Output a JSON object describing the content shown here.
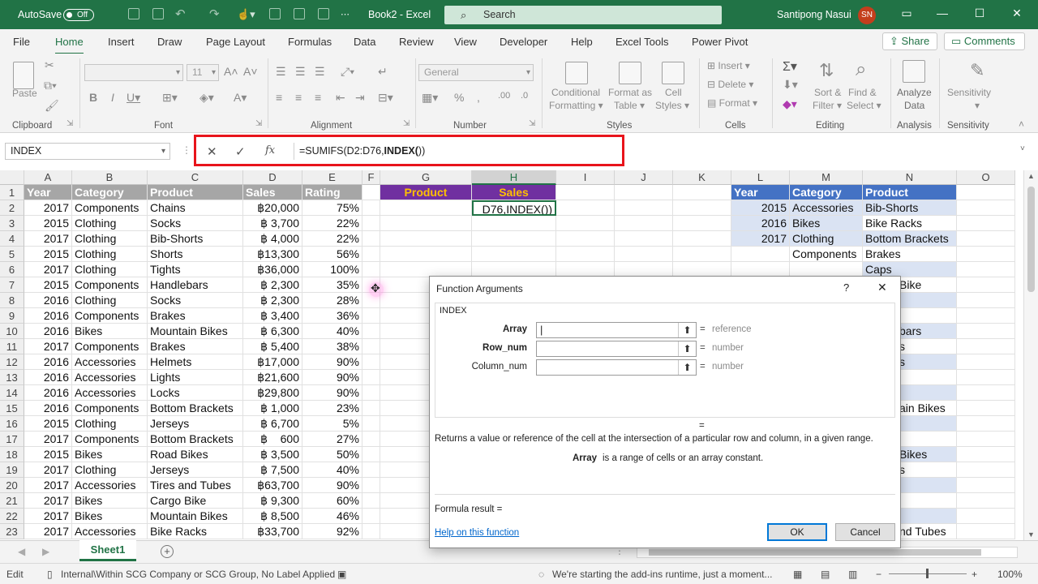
{
  "titlebar": {
    "autosave_label": "AutoSave",
    "autosave_state": "Off",
    "doc_title": "Book2 - Excel",
    "search_placeholder": "Search",
    "user_name": "Santipong Nasui",
    "user_initials": "SN"
  },
  "menu": {
    "items": [
      "File",
      "Home",
      "Insert",
      "Draw",
      "Page Layout",
      "Formulas",
      "Data",
      "Review",
      "View",
      "Developer",
      "Help",
      "Excel Tools",
      "Power Pivot"
    ],
    "active": "Home",
    "share_label": "Share",
    "comments_label": "Comments"
  },
  "ribbon": {
    "groups": [
      "Clipboard",
      "Font",
      "Alignment",
      "Number",
      "Styles",
      "Cells",
      "Editing",
      "Analysis",
      "Sensitivity"
    ],
    "paste": "Paste",
    "font_size": "11",
    "number_format": "General",
    "conditional_formatting": [
      "Conditional",
      "Formatting ▾"
    ],
    "format_as_table": [
      "Format as",
      "Table ▾"
    ],
    "cell_styles": [
      "Cell",
      "Styles ▾"
    ],
    "insert": "Insert",
    "delete": "Delete",
    "format": "Format",
    "sort_filter": [
      "Sort &",
      "Filter ▾"
    ],
    "find_select": [
      "Find &",
      "Select ▾"
    ],
    "analyze_data": [
      "Analyze",
      "Data"
    ],
    "sensitivity": "Sensitivity"
  },
  "formula_bar": {
    "name_box": "INDEX",
    "formula_prefix": "=SUMIFS(D2:D76,",
    "formula_bold": "INDEX(",
    "formula_suffix": "))"
  },
  "columns": [
    "A",
    "B",
    "C",
    "D",
    "E",
    "F",
    "G",
    "H",
    "I",
    "J",
    "K",
    "L",
    "M",
    "N",
    "O"
  ],
  "rows": [
    "1",
    "2",
    "3",
    "4",
    "5",
    "6",
    "7",
    "8",
    "9",
    "10",
    "11",
    "12",
    "13",
    "14",
    "15",
    "16",
    "17",
    "18",
    "19",
    "20",
    "21",
    "22",
    "23"
  ],
  "table_main": {
    "headers": [
      "Year",
      "Category",
      "Product",
      "Sales",
      "Rating"
    ],
    "data": [
      [
        "2017",
        "Components",
        "Chains",
        "฿20,000",
        "75%"
      ],
      [
        "2015",
        "Clothing",
        "Socks",
        "฿ 3,700",
        "22%"
      ],
      [
        "2017",
        "Clothing",
        "Bib-Shorts",
        "฿ 4,000",
        "22%"
      ],
      [
        "2015",
        "Clothing",
        "Shorts",
        "฿13,300",
        "56%"
      ],
      [
        "2017",
        "Clothing",
        "Tights",
        "฿36,000",
        "100%"
      ],
      [
        "2015",
        "Components",
        "Handlebars",
        "฿ 2,300",
        "35%"
      ],
      [
        "2016",
        "Clothing",
        "Socks",
        "฿ 2,300",
        "28%"
      ],
      [
        "2016",
        "Components",
        "Brakes",
        "฿ 3,400",
        "36%"
      ],
      [
        "2016",
        "Bikes",
        "Mountain Bikes",
        "฿ 6,300",
        "40%"
      ],
      [
        "2017",
        "Components",
        "Brakes",
        "฿ 5,400",
        "38%"
      ],
      [
        "2016",
        "Accessories",
        "Helmets",
        "฿17,000",
        "90%"
      ],
      [
        "2016",
        "Accessories",
        "Lights",
        "฿21,600",
        "90%"
      ],
      [
        "2016",
        "Accessories",
        "Locks",
        "฿29,800",
        "90%"
      ],
      [
        "2016",
        "Components",
        "Bottom Brackets",
        "฿ 1,000",
        "23%"
      ],
      [
        "2015",
        "Clothing",
        "Jerseys",
        "฿ 6,700",
        "5%"
      ],
      [
        "2017",
        "Components",
        "Bottom Brackets",
        "฿    600",
        "27%"
      ],
      [
        "2015",
        "Bikes",
        "Road Bikes",
        "฿ 3,500",
        "50%"
      ],
      [
        "2017",
        "Clothing",
        "Jerseys",
        "฿ 7,500",
        "40%"
      ],
      [
        "2017",
        "Accessories",
        "Tires and Tubes",
        "฿63,700",
        "90%"
      ],
      [
        "2017",
        "Bikes",
        "Cargo Bike",
        "฿ 9,300",
        "60%"
      ],
      [
        "2017",
        "Bikes",
        "Mountain Bikes",
        "฿ 8,500",
        "46%"
      ],
      [
        "2017",
        "Accessories",
        "Bike Racks",
        "฿33,700",
        "92%"
      ]
    ]
  },
  "criteria": {
    "product_header": "Product",
    "sales_header": "Sales",
    "active_cell_text": "D76,INDEX())"
  },
  "lists": {
    "headers": [
      "Year",
      "Category",
      "Product"
    ],
    "years": [
      "2015",
      "2016",
      "2017"
    ],
    "categories": [
      "Accessories",
      "Bikes",
      "Clothing",
      "Components"
    ],
    "products": [
      "Bib-Shorts",
      "Bike Racks",
      "Bottom Brackets",
      "Brakes",
      "Caps",
      "Bike",
      "",
      "",
      "bars",
      "s",
      "s",
      "",
      "",
      "ain Bikes",
      "",
      "",
      "Bikes",
      "s",
      "",
      "",
      "",
      "nd Tubes"
    ]
  },
  "dialog": {
    "title": "Function Arguments",
    "help_glyph": "?",
    "function_name": "INDEX",
    "args": [
      {
        "label": "Array",
        "hint": "reference"
      },
      {
        "label": "Row_num",
        "hint": "number"
      },
      {
        "label": "Column_num",
        "hint": "number"
      }
    ],
    "equals": "=",
    "description": "Returns a value or reference of the cell at the intersection of a particular row and column, in a given range.",
    "arg_name": "Array",
    "arg_description": "is a range of cells or an array constant.",
    "formula_result": "Formula result =",
    "help_link": "Help on this function",
    "ok": "OK",
    "cancel": "Cancel"
  },
  "sheet_tab": "Sheet1",
  "status": {
    "mode": "Edit",
    "label": "Internal\\Within SCG Company or SCG Group, No Label Applied",
    "addins": "We're starting the add-ins runtime, just a moment...",
    "zoom": "100%"
  }
}
